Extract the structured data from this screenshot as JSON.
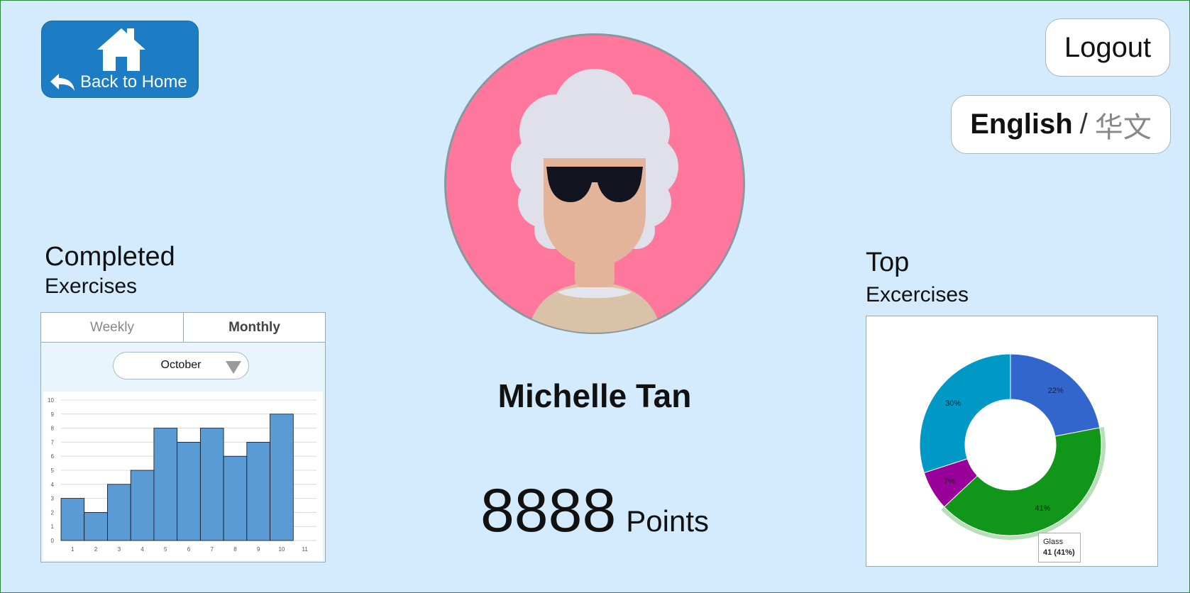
{
  "home": {
    "label": "Back to Home"
  },
  "logout": {
    "label": "Logout"
  },
  "language": {
    "english": "English",
    "separator": "/",
    "chinese": "华文"
  },
  "profile": {
    "name": "Michelle Tan",
    "points_value": "8888",
    "points_label": "Points"
  },
  "completed": {
    "title": "Completed",
    "subtitle": "Exercises",
    "tabs": [
      {
        "label": "Weekly"
      },
      {
        "label": "Monthly"
      }
    ],
    "active_tab": "Monthly",
    "month": "October"
  },
  "top": {
    "title": "Top",
    "subtitle": "Excercises"
  },
  "tooltip": {
    "name": "Glass",
    "value": "41 (41%)"
  },
  "colors": {
    "background": "#d3ebfc",
    "home_button": "#1d7dc4",
    "avatar_bg": "#ff779d",
    "bar": "#5b9bd5"
  },
  "icons": {
    "home": "house-icon",
    "back": "back-arrow-icon",
    "dropdown": "caret-down-icon"
  },
  "chart_data": [
    {
      "type": "bar",
      "categories": [
        "1",
        "2",
        "3",
        "4",
        "5",
        "6",
        "7",
        "8",
        "9",
        "10",
        "11"
      ],
      "values": [
        3,
        2,
        4,
        5,
        8,
        7,
        8,
        6,
        7,
        9,
        0
      ],
      "xticks": [
        "1",
        "2",
        "3",
        "4",
        "5",
        "6",
        "7",
        "8",
        "9",
        "10",
        "11"
      ],
      "yticks": [
        "0",
        "1",
        "2",
        "3",
        "4",
        "5",
        "6",
        "7",
        "8",
        "9",
        "10"
      ],
      "ylim": [
        0,
        10
      ],
      "grid": true,
      "bar_color": "#5b9bd5"
    },
    {
      "type": "pie",
      "donut": true,
      "slices": [
        {
          "value": 22,
          "label": "22%",
          "color": "#3366cc"
        },
        {
          "name": "Glass",
          "value": 41,
          "label": "41%",
          "color": "#109618"
        },
        {
          "value": 7,
          "label": "7%",
          "color": "#990099"
        },
        {
          "value": 30,
          "label": "30%",
          "color": "#0099c6"
        }
      ],
      "highlighted": "Glass"
    }
  ]
}
